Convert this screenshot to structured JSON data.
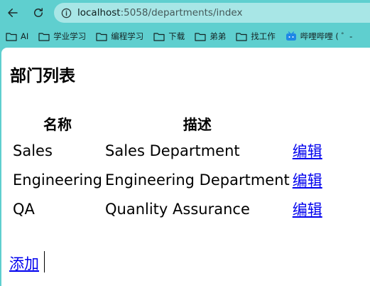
{
  "browser": {
    "url_host": "localhost",
    "url_path": ":5058/departments/index",
    "bookmarks": [
      {
        "label": "AI",
        "icon": "folder-icon"
      },
      {
        "label": "学业学习",
        "icon": "folder-icon"
      },
      {
        "label": "编程学习",
        "icon": "folder-icon"
      },
      {
        "label": "下载",
        "icon": "folder-icon"
      },
      {
        "label": "弟弟",
        "icon": "folder-icon"
      },
      {
        "label": "找工作",
        "icon": "folder-icon"
      },
      {
        "label": "哔哩哔哩 ( ゜-",
        "icon": "bilibili-icon"
      }
    ]
  },
  "page": {
    "title": "部门列表",
    "table": {
      "headers": [
        "名称",
        "描述",
        ""
      ],
      "rows": [
        {
          "name": "Sales",
          "description": "Sales Department",
          "action": "编辑"
        },
        {
          "name": "Engineering",
          "description": "Engineering Department",
          "action": "编辑"
        },
        {
          "name": "QA",
          "description": "Quanlity Assurance",
          "action": "编辑"
        }
      ]
    },
    "add_label": "添加"
  },
  "colors": {
    "chrome": "#5fcfcf",
    "omnibox": "#a8e6e6",
    "link": "#0000ee"
  }
}
